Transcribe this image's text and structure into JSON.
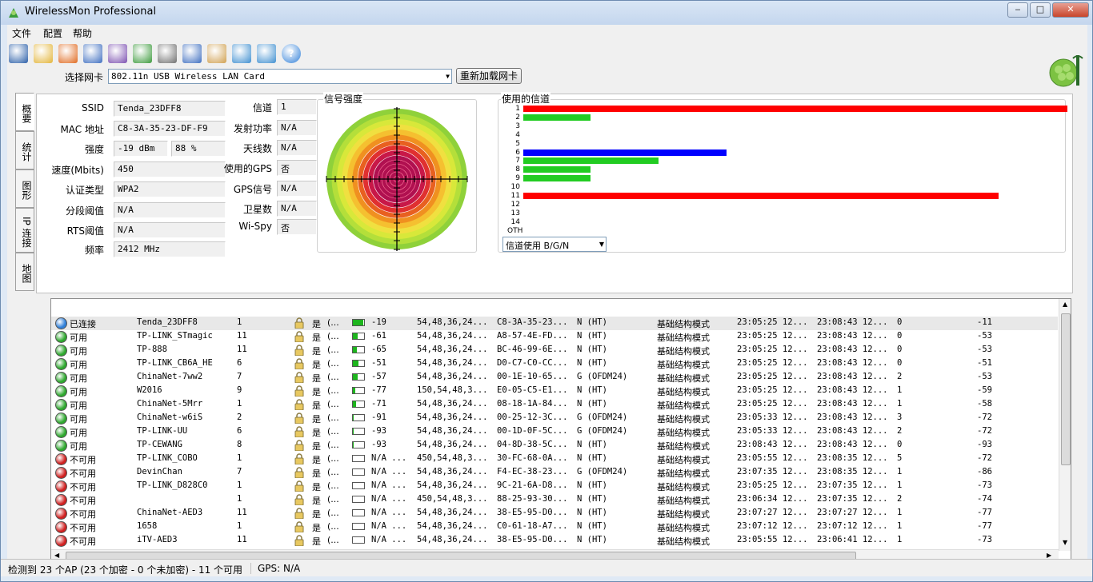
{
  "window": {
    "title": "WirelessMon Professional",
    "min_label": "‒",
    "max_label": "□",
    "close_label": "✕"
  },
  "menu": [
    "文件",
    "配置",
    "帮助"
  ],
  "toolbar_icons": [
    "save-icon",
    "open-folder-icon",
    "record-icon",
    "network-icon",
    "network-config-icon",
    "export-icon",
    "print-icon",
    "settings-icon",
    "clipboard-icon",
    "globe-icon",
    "info-icon",
    "help-icon"
  ],
  "adapter": {
    "label": "选择网卡",
    "value": "802.11n USB Wireless LAN Card",
    "reload_label": "重新加载网卡"
  },
  "tabs": [
    "概要",
    "统计",
    "图形",
    "IP 连接",
    "地图"
  ],
  "fields_left": [
    {
      "label": "SSID",
      "value": "Tenda_23DFF8"
    },
    {
      "label": "MAC 地址",
      "value": "C8-3A-35-23-DF-F9"
    },
    {
      "label": "强度",
      "value": "-19 dBm",
      "value2": "88 %"
    },
    {
      "label": "速度(Mbits)",
      "value": "450"
    },
    {
      "label": "认证类型",
      "value": "WPA2"
    },
    {
      "label": "分段阈值",
      "value": "N/A"
    },
    {
      "label": "RTS阈值",
      "value": "N/A"
    },
    {
      "label": "频率",
      "value": "2412 MHz"
    }
  ],
  "fields_right": [
    {
      "label": "信道",
      "value": "1"
    },
    {
      "label": "发射功率",
      "value": "N/A"
    },
    {
      "label": "天线数",
      "value": "N/A"
    },
    {
      "label": "使用的GPS",
      "value": "否"
    },
    {
      "label": "GPS信号",
      "value": "N/A"
    },
    {
      "label": "卫星数",
      "value": "N/A"
    },
    {
      "label": "Wi-Spy",
      "value": "否"
    }
  ],
  "signal": {
    "title": "信号强度"
  },
  "channels": {
    "title": "使用的信道",
    "labels": [
      "1",
      "2",
      "3",
      "4",
      "5",
      "6",
      "7",
      "8",
      "9",
      "10",
      "11",
      "12",
      "13",
      "14",
      "OTH"
    ],
    "usage": [
      1.0,
      0.124,
      0,
      0,
      0,
      0.374,
      0.249,
      0.124,
      0.124,
      0,
      0.874,
      0,
      0,
      0,
      0
    ],
    "colors": [
      "#ff0000",
      "#22cc22",
      "",
      "",
      "",
      "#0000ff",
      "#22cc22",
      "#22cc22",
      "#22cc22",
      "",
      "#ff0000",
      "",
      "",
      "",
      ""
    ],
    "filter": "信道使用 B/G/N"
  },
  "ap_list": [
    {
      "state": "已连接",
      "ok": "connected",
      "ssid": "Tenda_23DFF8",
      "ch": "1",
      "enc": "是",
      "sec": "(...",
      "sig": "-19",
      "sigfrac": 0.9,
      "rates": "54,48,36,24...",
      "mac": "C8-3A-35-23...",
      "phy": "N (HT)",
      "mode": "基础结构模式",
      "first": "23:05:25 12...",
      "last": "23:08:43 12...",
      "cnt": "0",
      "rssi": "-11"
    },
    {
      "state": "可用",
      "ok": "yes",
      "ssid": "TP-LINK_STmagic",
      "ch": "11",
      "enc": "是",
      "sec": "(...",
      "sig": "-61",
      "sigfrac": 0.4,
      "rates": "54,48,36,24...",
      "mac": "A8-57-4E-FD...",
      "phy": "N (HT)",
      "mode": "基础结构模式",
      "first": "23:05:25 12...",
      "last": "23:08:43 12...",
      "cnt": "0",
      "rssi": "-53"
    },
    {
      "state": "可用",
      "ok": "yes",
      "ssid": "TP-888",
      "ch": "11",
      "enc": "是",
      "sec": "(...",
      "sig": "-65",
      "sigfrac": 0.35,
      "rates": "54,48,36,24...",
      "mac": "BC-46-99-6E...",
      "phy": "N (HT)",
      "mode": "基础结构模式",
      "first": "23:05:25 12...",
      "last": "23:08:43 12...",
      "cnt": "0",
      "rssi": "-53"
    },
    {
      "state": "可用",
      "ok": "yes",
      "ssid": "TP-LINK_CB6A_HE",
      "ch": "6",
      "enc": "是",
      "sec": "(...",
      "sig": "-51",
      "sigfrac": 0.5,
      "rates": "54,48,36,24...",
      "mac": "D0-C7-C0-CC...",
      "phy": "N (HT)",
      "mode": "基础结构模式",
      "first": "23:05:25 12...",
      "last": "23:08:43 12...",
      "cnt": "0",
      "rssi": "-51"
    },
    {
      "state": "可用",
      "ok": "yes",
      "ssid": "ChinaNet-7ww2",
      "ch": "7",
      "enc": "是",
      "sec": "(...",
      "sig": "-57",
      "sigfrac": 0.45,
      "rates": "54,48,36,24...",
      "mac": "00-1E-10-65...",
      "phy": "G (OFDM24)",
      "mode": "基础结构模式",
      "first": "23:05:25 12...",
      "last": "23:08:43 12...",
      "cnt": "2",
      "rssi": "-53"
    },
    {
      "state": "可用",
      "ok": "yes",
      "ssid": "W2016",
      "ch": "9",
      "enc": "是",
      "sec": "(...",
      "sig": "-77",
      "sigfrac": 0.2,
      "rates": "150,54,48,3...",
      "mac": "E0-05-C5-E1...",
      "phy": "N (HT)",
      "mode": "基础结构模式",
      "first": "23:05:25 12...",
      "last": "23:08:43 12...",
      "cnt": "1",
      "rssi": "-59"
    },
    {
      "state": "可用",
      "ok": "yes",
      "ssid": "ChinaNet-5Mrr",
      "ch": "1",
      "enc": "是",
      "sec": "(...",
      "sig": "-71",
      "sigfrac": 0.25,
      "rates": "54,48,36,24...",
      "mac": "08-18-1A-84...",
      "phy": "N (HT)",
      "mode": "基础结构模式",
      "first": "23:05:25 12...",
      "last": "23:08:43 12...",
      "cnt": "1",
      "rssi": "-58"
    },
    {
      "state": "可用",
      "ok": "yes",
      "ssid": "ChinaNet-w6iS",
      "ch": "2",
      "enc": "是",
      "sec": "(...",
      "sig": "-91",
      "sigfrac": 0.05,
      "rates": "54,48,36,24...",
      "mac": "00-25-12-3C...",
      "phy": "G (OFDM24)",
      "mode": "基础结构模式",
      "first": "23:05:33 12...",
      "last": "23:08:43 12...",
      "cnt": "3",
      "rssi": "-72"
    },
    {
      "state": "可用",
      "ok": "yes",
      "ssid": "TP-LINK-UU",
      "ch": "6",
      "enc": "是",
      "sec": "(...",
      "sig": "-93",
      "sigfrac": 0.04,
      "rates": "54,48,36,24...",
      "mac": "00-1D-0F-5C...",
      "phy": "G (OFDM24)",
      "mode": "基础结构模式",
      "first": "23:05:33 12...",
      "last": "23:08:43 12...",
      "cnt": "2",
      "rssi": "-72"
    },
    {
      "state": "可用",
      "ok": "yes",
      "ssid": "TP-CEWANG",
      "ch": "8",
      "enc": "是",
      "sec": "(...",
      "sig": "-93",
      "sigfrac": 0.04,
      "rates": "54,48,36,24...",
      "mac": "04-8D-38-5C...",
      "phy": "N (HT)",
      "mode": "基础结构模式",
      "first": "23:08:43 12...",
      "last": "23:08:43 12...",
      "cnt": "0",
      "rssi": "-93"
    },
    {
      "state": "不可用",
      "ok": "no",
      "ssid": "TP-LINK_COBO",
      "ch": "1",
      "enc": "是",
      "sec": "(...",
      "sig": "N/A ...",
      "sigfrac": 0,
      "rates": "450,54,48,3...",
      "mac": "30-FC-68-0A...",
      "phy": "N (HT)",
      "mode": "基础结构模式",
      "first": "23:05:55 12...",
      "last": "23:08:35 12...",
      "cnt": "5",
      "rssi": "-72"
    },
    {
      "state": "不可用",
      "ok": "no",
      "ssid": "DevinChan",
      "ch": "7",
      "enc": "是",
      "sec": "(...",
      "sig": "N/A ...",
      "sigfrac": 0,
      "rates": "54,48,36,24...",
      "mac": "F4-EC-38-23...",
      "phy": "G (OFDM24)",
      "mode": "基础结构模式",
      "first": "23:07:35 12...",
      "last": "23:08:35 12...",
      "cnt": "1",
      "rssi": "-86"
    },
    {
      "state": "不可用",
      "ok": "no",
      "ssid": "TP-LINK_D828C0",
      "ch": "1",
      "enc": "是",
      "sec": "(...",
      "sig": "N/A ...",
      "sigfrac": 0,
      "rates": "54,48,36,24...",
      "mac": "9C-21-6A-D8...",
      "phy": "N (HT)",
      "mode": "基础结构模式",
      "first": "23:05:25 12...",
      "last": "23:07:35 12...",
      "cnt": "1",
      "rssi": "-73"
    },
    {
      "state": "不可用",
      "ok": "no",
      "ssid": "",
      "ch": "1",
      "enc": "是",
      "sec": "(...",
      "sig": "N/A ...",
      "sigfrac": 0,
      "rates": "450,54,48,3...",
      "mac": "88-25-93-30...",
      "phy": "N (HT)",
      "mode": "基础结构模式",
      "first": "23:06:34 12...",
      "last": "23:07:35 12...",
      "cnt": "2",
      "rssi": "-74"
    },
    {
      "state": "不可用",
      "ok": "no",
      "ssid": "ChinaNet-AED3",
      "ch": "11",
      "enc": "是",
      "sec": "(...",
      "sig": "N/A ...",
      "sigfrac": 0,
      "rates": "54,48,36,24...",
      "mac": "38-E5-95-D0...",
      "phy": "N (HT)",
      "mode": "基础结构模式",
      "first": "23:07:27 12...",
      "last": "23:07:27 12...",
      "cnt": "1",
      "rssi": "-77"
    },
    {
      "state": "不可用",
      "ok": "no",
      "ssid": "1658",
      "ch": "1",
      "enc": "是",
      "sec": "(...",
      "sig": "N/A ...",
      "sigfrac": 0,
      "rates": "54,48,36,24...",
      "mac": "C0-61-18-A7...",
      "phy": "N (HT)",
      "mode": "基础结构模式",
      "first": "23:07:12 12...",
      "last": "23:07:12 12...",
      "cnt": "1",
      "rssi": "-77"
    },
    {
      "state": "不可用",
      "ok": "no",
      "ssid": "iTV-AED3",
      "ch": "11",
      "enc": "是",
      "sec": "(...",
      "sig": "N/A ...",
      "sigfrac": 0,
      "rates": "54,48,36,24...",
      "mac": "38-E5-95-D0...",
      "phy": "N (HT)",
      "mode": "基础结构模式",
      "first": "23:05:55 12...",
      "last": "23:06:41 12...",
      "cnt": "1",
      "rssi": "-73"
    }
  ],
  "status": {
    "left": "检测到 23 个AP (23 个加密 - 0 个未加密) - 11 个可用",
    "gps": "GPS: N/A"
  },
  "colors": {
    "connected": "#2f7fd8",
    "available": "#2ea82e",
    "unavailable": "#d02020"
  }
}
